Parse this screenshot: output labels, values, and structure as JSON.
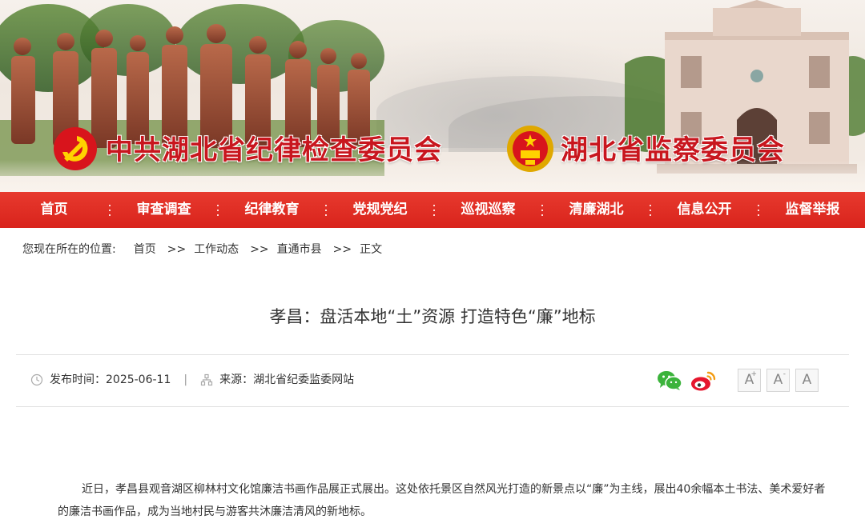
{
  "banner": {
    "title_left": "中共湖北省纪律检查委员会",
    "title_right": "湖北省监察委员会",
    "brand_color": "#c8161e"
  },
  "nav": {
    "items": [
      "首页",
      "审查调查",
      "纪律教育",
      "党规党纪",
      "巡视巡察",
      "清廉湖北",
      "信息公开",
      "监督举报"
    ],
    "bg_color": "#d9231c"
  },
  "breadcrumb": {
    "prefix": "您现在所在的位置:",
    "items": [
      "首页",
      "工作动态",
      "直通市县",
      "正文"
    ],
    "separator": ">>"
  },
  "article": {
    "title": "孝昌：盘活本地“土”资源 打造特色“廉”地标",
    "publish_label": "发布时间：",
    "publish_date": "2025-06-11",
    "meta_divider": "|",
    "source_label": "来源：",
    "source": "湖北省纪委监委网站",
    "paragraph_1": "近日，孝昌县观音湖区柳林村文化馆廉洁书画作品展正式展出。这处依托景区自然风光打造的新景点以“廉”为主线，展出40余幅本土书法、美术爱好者的廉洁书画作品，成为当地村民与游客共沐廉洁清风的新地标。"
  },
  "share": {
    "icons": [
      "wechat-icon",
      "weibo-icon"
    ]
  },
  "font_size": {
    "letter": "A",
    "increase_mark": "+",
    "decrease_mark": "-"
  }
}
